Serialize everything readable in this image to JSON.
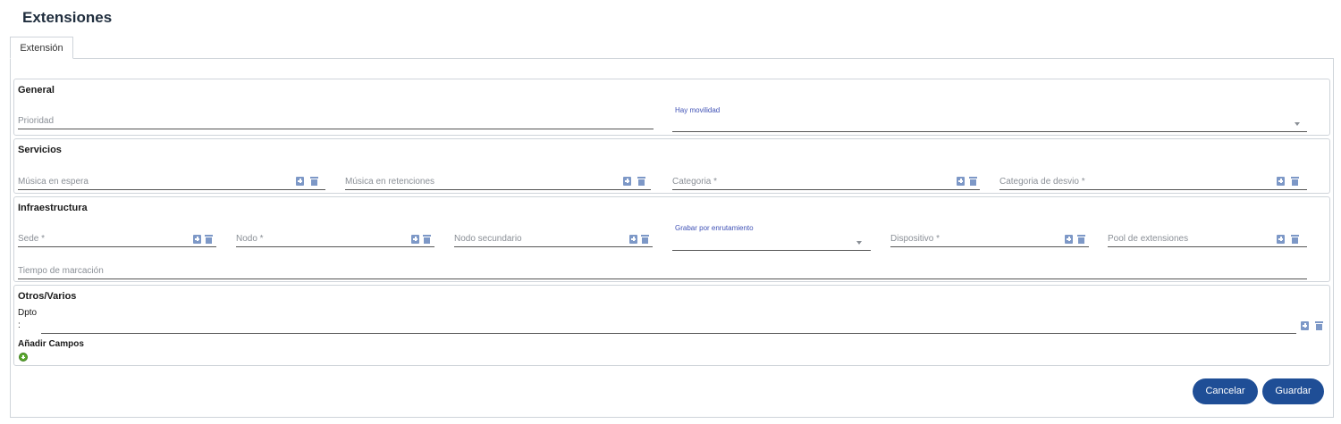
{
  "page": {
    "title": "Extensiones"
  },
  "tabs": [
    {
      "label": "Extensión"
    }
  ],
  "sections": {
    "general": {
      "title": "General",
      "prioridad": {
        "placeholder": "Prioridad"
      },
      "hay_movilidad": {
        "label": "Hay movilidad"
      }
    },
    "servicios": {
      "title": "Servicios",
      "musica_espera": {
        "placeholder": "Música en espera"
      },
      "musica_retenciones": {
        "placeholder": "Música en retenciones"
      },
      "categoria": {
        "placeholder": "Categoria *"
      },
      "categoria_desvio": {
        "placeholder": "Categoria de desvio *"
      }
    },
    "infraestructura": {
      "title": "Infraestructura",
      "sede": {
        "placeholder": "Sede *"
      },
      "nodo": {
        "placeholder": "Nodo *"
      },
      "nodo_secundario": {
        "placeholder": "Nodo secundario"
      },
      "grabar": {
        "label": "Grabar por enrutamiento"
      },
      "dispositivo": {
        "placeholder": "Dispositivo *"
      },
      "pool": {
        "placeholder": "Pool de extensiones"
      },
      "tiempo_marcacion": {
        "placeholder": "Tiempo de marcación"
      }
    },
    "otros": {
      "title": "Otros/Varios",
      "dpto_label": "Dpto",
      "dpto_colon": ":",
      "add_fields_label": "Añadir Campos"
    }
  },
  "actions": {
    "cancel": "Cancelar",
    "save": "Guardar"
  },
  "colors": {
    "primary_button": "#1f4e96",
    "float_label": "#3f51b5",
    "icon": "#7d98c7",
    "add_icon": "#5aa82e"
  },
  "icons": [
    "add-icon",
    "trash-icon",
    "dropdown-caret-icon",
    "add-circle-icon"
  ]
}
